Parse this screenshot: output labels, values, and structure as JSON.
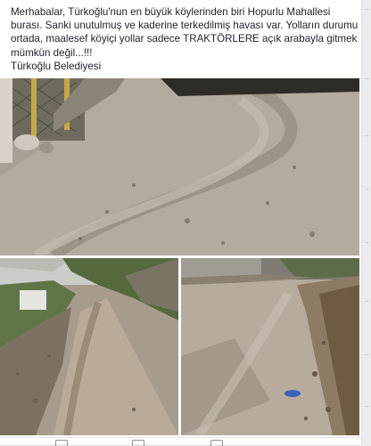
{
  "post": {
    "lines": [
      "Merhabalar, Türkoğlu'nun en büyük köylerinden biri Hopurlu Mahallesi",
      "burası. Sanki unutulmuş ve kaderine terkedilmiş havası var. Yolların durumu",
      "ortada, maalesef köyiçi yollar sadece TRAKTÖRLERE açık arabayla gitmek",
      "mümkün değil...!!!",
      "Türkoğlu Belediyesi"
    ]
  },
  "photos": [
    {
      "subject": "dirt-road-with-fence"
    },
    {
      "subject": "dirt-road-downhill"
    },
    {
      "subject": "dirt-road-with-rocky-edge"
    }
  ],
  "actions": {
    "icons": [
      "like-icon",
      "comment-icon",
      "share-icon"
    ]
  }
}
